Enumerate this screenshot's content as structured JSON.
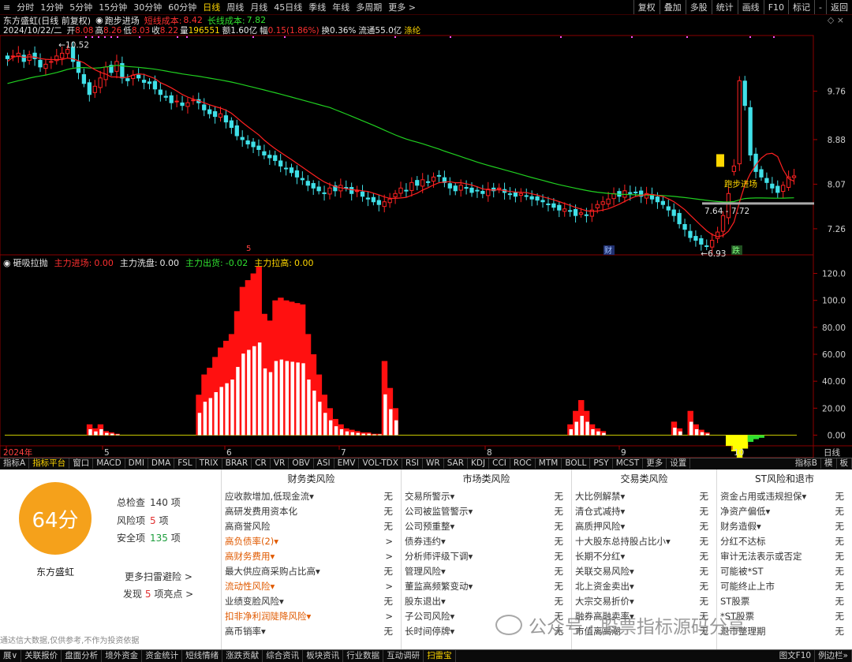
{
  "toolbar": {
    "periods": [
      "分时",
      "1分钟",
      "5分钟",
      "15分钟",
      "30分钟",
      "60分钟",
      "日线",
      "周线",
      "月线",
      "45日线",
      "季线",
      "年线",
      "多周期",
      "更多 >"
    ],
    "active_period": "日线",
    "right_buttons": [
      "复权",
      "叠加",
      "多股",
      "统计",
      "画线",
      "F10",
      "标记",
      "-",
      "返回"
    ]
  },
  "header": {
    "stock_title": "东方盛虹(日线 前复权)",
    "indicator_name": "跑步进场",
    "short_cost_label": "短线成本:",
    "short_cost_value": "8.42",
    "long_cost_label": "长线成本:",
    "long_cost_value": "7.82",
    "date": "2024/10/22/二",
    "open_label": "开",
    "open_value": "8.08",
    "high_label": "高",
    "high_value": "8.26",
    "low_label": "低",
    "low_value": "8.03",
    "close_label": "收",
    "close_value": "8.22",
    "volume_label": "量",
    "volume_value": "196551",
    "amount_label": "额",
    "amount_value": "1.60亿",
    "change_label": "幅",
    "change_value": "0.15(1.86%)",
    "turnover_label": "换",
    "turnover_value": "0.36%",
    "float_label": "流通",
    "float_value": "55.0亿",
    "concept": "涤纶"
  },
  "indicator_header": {
    "name": "砸吸拉抛",
    "l1": "主力进场:",
    "v1": "0.00",
    "l2": "主力洗盘:",
    "v2": "0.00",
    "l3": "主力出货:",
    "v3": "-0.02",
    "l4": "主力拉高:",
    "v4": "0.00"
  },
  "price_axis": [
    "9.76",
    "8.88",
    "8.07",
    "7.26"
  ],
  "indicator_axis": [
    "120.0",
    "100.0",
    "80.00",
    "60.00",
    "40.00",
    "20.00",
    "0.00"
  ],
  "date_axis": [
    "2024年",
    "5",
    "6",
    "7",
    "8",
    "9",
    "10"
  ],
  "date_axis_right": "日线",
  "annotations": {
    "high_price": "10.52",
    "low_price": "6.93",
    "range_label": "7.64 - 7.72",
    "signal_label": "跑步进场",
    "event_cai": "财",
    "event_die": "跌",
    "event_dot": "5"
  },
  "indicator_tabs": [
    "指标A",
    "指标平台",
    "窗口",
    "MACD",
    "DMI",
    "DMA",
    "FSL",
    "TRIX",
    "BRAR",
    "CR",
    "VR",
    "OBV",
    "ASI",
    "EMV",
    "VOL-TDX",
    "RSI",
    "WR",
    "SAR",
    "KDJ",
    "CCI",
    "ROC",
    "MTM",
    "BOLL",
    "PSY",
    "MCST",
    "更多",
    "设置"
  ],
  "indicator_tabs_right": [
    "指标B",
    "模",
    "板"
  ],
  "colors": {
    "up": "#ff2222",
    "down": "#40e0e8",
    "ma_short": "#ff2020",
    "ma_long": "#20d020",
    "score": "#f5a11b"
  },
  "chart_data": {
    "type": "candlestick",
    "title": "东方盛虹(日线 前复权)",
    "x_axis_labels": [
      "2024年",
      "5",
      "6",
      "7",
      "8",
      "9",
      "10"
    ],
    "ylim": [
      6.8,
      10.7
    ],
    "y_ticks": [
      9.76,
      8.88,
      8.07,
      7.26
    ],
    "close": [
      10.35,
      10.4,
      10.45,
      10.3,
      10.42,
      10.35,
      10.2,
      10.25,
      10.3,
      10.4,
      10.45,
      10.52,
      10.3,
      10.1,
      9.9,
      9.7,
      9.85,
      10.0,
      10.2,
      10.1,
      10.3,
      10.0,
      9.95,
      10.05,
      10.0,
      9.92,
      9.9,
      9.8,
      9.7,
      9.65,
      9.55,
      9.58,
      9.5,
      9.55,
      9.6,
      9.55,
      9.42,
      9.35,
      9.3,
      9.35,
      9.2,
      9.1,
      8.95,
      8.88,
      8.8,
      8.75,
      8.7,
      8.6,
      8.55,
      8.5,
      8.4,
      8.35,
      8.28,
      8.2,
      8.15,
      8.05,
      8.0,
      7.95,
      7.9,
      8.0,
      7.95,
      8.05,
      8.0,
      7.9,
      7.95,
      7.85,
      7.8,
      7.75,
      7.7,
      7.75,
      7.8,
      7.9,
      8.0,
      7.95,
      8.1,
      8.05,
      8.15,
      8.1,
      8.2,
      8.22,
      8.1,
      8.0,
      7.95,
      8.05,
      8.0,
      7.92,
      7.95,
      7.9,
      7.98,
      7.95,
      8.0,
      7.92,
      7.88,
      7.85,
      7.9,
      7.85,
      7.8,
      7.78,
      7.75,
      7.7,
      7.65,
      7.6,
      7.62,
      7.58,
      7.5,
      7.55,
      7.5,
      7.6,
      7.7,
      7.75,
      7.8,
      7.9,
      7.85,
      7.95,
      7.9,
      7.92,
      7.85,
      7.9,
      7.8,
      7.75,
      7.7,
      7.6,
      7.5,
      7.35,
      7.25,
      7.1,
      7.05,
      6.98,
      6.95,
      7.05,
      7.2,
      7.5,
      7.9,
      8.4,
      9.95,
      9.5,
      8.6,
      8.3,
      8.2,
      8.1,
      8.0,
      7.92,
      8.05,
      8.2,
      8.22
    ],
    "ma_short_range": [
      10.3,
      7.6
    ],
    "ma_long_range": [
      9.9,
      7.82
    ],
    "indicator": {
      "type": "bar",
      "ylim": [
        -5,
        125
      ],
      "y_ticks": [
        0,
        20,
        40,
        60,
        80,
        100,
        120
      ],
      "series": [
        {
          "values": [
            0,
            0,
            0,
            0,
            0,
            0,
            0,
            0,
            0,
            0,
            0,
            0,
            0,
            0,
            0,
            8,
            5,
            8,
            3,
            2,
            1,
            0,
            0,
            0,
            0,
            0,
            0,
            0,
            0,
            0,
            0,
            0,
            0,
            0,
            0,
            0,
            0,
            0,
            0,
            0,
            0,
            0,
            0,
            0,
            0,
            0,
            0,
            0,
            0,
            0,
            0,
            0,
            0,
            0,
            0,
            0,
            0,
            0,
            0,
            0,
            0,
            0,
            0,
            0,
            0,
            0,
            0,
            0,
            0,
            0,
            0,
            0,
            0,
            0,
            0,
            0,
            0,
            0,
            0,
            0,
            0,
            0,
            0,
            0,
            0,
            0,
            0,
            0,
            0,
            0,
            0,
            0,
            0,
            0,
            0,
            0,
            0,
            0,
            0,
            0,
            0,
            0,
            0,
            0,
            0,
            0,
            0,
            0,
            0,
            0,
            0,
            0,
            0,
            0,
            0,
            0,
            0,
            0,
            0,
            0,
            0,
            0,
            0,
            0,
            0,
            0,
            0,
            0,
            0,
            0,
            0,
            0,
            0,
            0,
            0,
            0,
            0,
            0,
            0,
            0,
            0,
            0,
            0,
            0,
            0,
            0,
            0,
            0,
            0,
            0,
            0,
            0,
            0
          ]
        },
        {
          "values": [
            0,
            0,
            0,
            0,
            0,
            0,
            0,
            0,
            0,
            0,
            0,
            0,
            0,
            0,
            0,
            0,
            0,
            0,
            0,
            0,
            0,
            0,
            0,
            0,
            0,
            0,
            0,
            0,
            0,
            0,
            0,
            0,
            0,
            0,
            0,
            30,
            45,
            50,
            58,
            65,
            70,
            75,
            92,
            110,
            115,
            120,
            125,
            90,
            85,
            100,
            102,
            100,
            99,
            98,
            97,
            75,
            60,
            45,
            30,
            20,
            12,
            8,
            5,
            4,
            3,
            2,
            2,
            1,
            1,
            0,
            0,
            0,
            0,
            0,
            0,
            0,
            0,
            0,
            0,
            0,
            0,
            0,
            0,
            0,
            0,
            0,
            0,
            0,
            0,
            0,
            0,
            0,
            0,
            0,
            0,
            0,
            0,
            0,
            0,
            0,
            0,
            0,
            0,
            0,
            0,
            0,
            0,
            0,
            0,
            0,
            0,
            0,
            0,
            0,
            0,
            0,
            0,
            0,
            0,
            0,
            0,
            0,
            0,
            0,
            0,
            0,
            0,
            0,
            0,
            0,
            0,
            0,
            0,
            0,
            0,
            0,
            0,
            0,
            0,
            0,
            0,
            0,
            0,
            0,
            0,
            0,
            0,
            0,
            0,
            0,
            0
          ]
        }
      ]
    }
  },
  "panel": {
    "score": "64分",
    "stock_name": "东方盛虹",
    "total_label": "总检查",
    "total_value": "140",
    "total_unit": "项",
    "risk_label": "风险项",
    "risk_value": "5",
    "risk_unit": "项",
    "safe_label": "安全项",
    "safe_value": "135",
    "safe_unit": "项",
    "more": "更多扫雷避险 >",
    "found_prefix": "发现",
    "found_value": "5",
    "found_suffix": "项亮点 >",
    "disclaimer": "通达信大数据,仅供参考,不作为投资依据",
    "columns": [
      {
        "title": "财务类风险",
        "rows": [
          {
            "name": "应收款增加,低现金流▾",
            "val": "无",
            "hl": false
          },
          {
            "name": "高研发费用资本化",
            "val": "无",
            "hl": false
          },
          {
            "name": "高商誉风险",
            "val": "无",
            "hl": false
          },
          {
            "name": "高负债率(2)▾",
            "val": ">",
            "hl": true
          },
          {
            "name": "高财务费用▾",
            "val": ">",
            "hl": true
          },
          {
            "name": "最大供应商采购占比高▾",
            "val": "无",
            "hl": false
          },
          {
            "name": "流动性风险▾",
            "val": ">",
            "hl": true
          },
          {
            "name": "业绩变脸风险▾",
            "val": "无",
            "hl": false
          },
          {
            "name": "扣非净利润陡降风险▾",
            "val": ">",
            "hl": true
          },
          {
            "name": "高币销率▾",
            "val": "无",
            "hl": false
          }
        ]
      },
      {
        "title": "市场类风险",
        "rows": [
          {
            "name": "交易所警示▾",
            "val": "无",
            "hl": false
          },
          {
            "name": "公司被监管警示▾",
            "val": "无",
            "hl": false
          },
          {
            "name": "公司预重整▾",
            "val": "无",
            "hl": false
          },
          {
            "name": "债券违约▾",
            "val": "无",
            "hl": false
          },
          {
            "name": "分析师评级下调▾",
            "val": "无",
            "hl": false
          },
          {
            "name": "管理风险▾",
            "val": "无",
            "hl": false
          },
          {
            "name": "董监高频繁变动▾",
            "val": "无",
            "hl": false
          },
          {
            "name": "股东退出▾",
            "val": "无",
            "hl": false
          },
          {
            "name": "子公司风险▾",
            "val": "无",
            "hl": false
          },
          {
            "name": "长时间停牌▾",
            "val": "无",
            "hl": false
          }
        ]
      },
      {
        "title": "交易类风险",
        "rows": [
          {
            "name": "大比例解禁▾",
            "val": "无",
            "hl": false
          },
          {
            "name": "清仓式减持▾",
            "val": "无",
            "hl": false
          },
          {
            "name": "高质押风险▾",
            "val": "无",
            "hl": false
          },
          {
            "name": "十大股东总持股占比小▾",
            "val": "无",
            "hl": false
          },
          {
            "name": "长期不分红▾",
            "val": "无",
            "hl": false
          },
          {
            "name": "关联交易风险▾",
            "val": "无",
            "hl": false
          },
          {
            "name": "北上资金卖出▾",
            "val": "无",
            "hl": false
          },
          {
            "name": "大宗交易折价▾",
            "val": "无",
            "hl": false
          },
          {
            "name": "融券高融卖率▾",
            "val": "无",
            "hl": false
          },
          {
            "name": "市值离高潮",
            "val": "无",
            "hl": false
          }
        ]
      },
      {
        "title": "ST风险和退市",
        "rows": [
          {
            "name": "资金占用或违规担保▾",
            "val": "无",
            "hl": false
          },
          {
            "name": "净资产偏低▾",
            "val": "无",
            "hl": false
          },
          {
            "name": "财务造假▾",
            "val": "无",
            "hl": false
          },
          {
            "name": "分红不达标",
            "val": "无",
            "hl": false
          },
          {
            "name": "审计无法表示或否定",
            "val": "无",
            "hl": false
          },
          {
            "name": "可能被*ST",
            "val": "无",
            "hl": false
          },
          {
            "name": "可能终止上市",
            "val": "无",
            "hl": false
          },
          {
            "name": "ST股票",
            "val": "无",
            "hl": false
          },
          {
            "name": "*ST股票",
            "val": "无",
            "hl": false
          },
          {
            "name": "退市整理期",
            "val": "无",
            "hl": false
          }
        ]
      }
    ]
  },
  "watermark": "公众号 · 股票指标源码分享",
  "bottom_tabs": [
    "展∨",
    "关联报价",
    "盘面分析",
    "境外资金",
    "资金统计",
    "短线情绪",
    "涨跌贡献",
    "综合资讯",
    "板块资讯",
    "行业数据",
    "互动调研",
    "扫雷宝"
  ],
  "bottom_active": "扫雷宝",
  "bottom_right": [
    "图文F10",
    "例边栏»"
  ]
}
